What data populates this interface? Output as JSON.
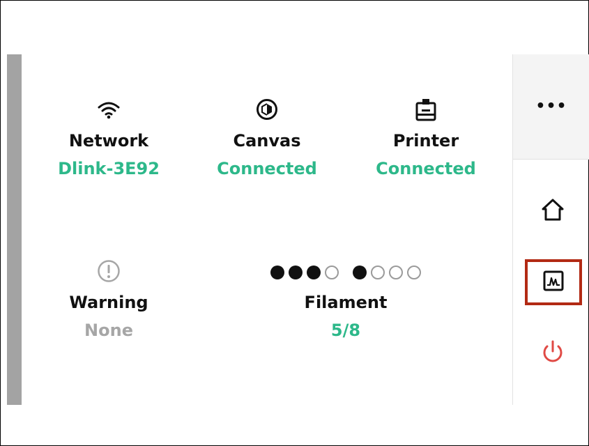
{
  "status": {
    "network": {
      "icon": "wifi-icon",
      "label": "Network",
      "value": "Dlink-3E92"
    },
    "canvas": {
      "icon": "canvas-cube-icon",
      "label": "Canvas",
      "value": "Connected"
    },
    "printer": {
      "icon": "printer-icon",
      "label": "Printer",
      "value": "Connected"
    },
    "warning": {
      "icon": "warning-circle-icon",
      "label": "Warning",
      "value": "None"
    },
    "filament": {
      "label": "Filament",
      "value": "5/8",
      "slots": [
        true,
        true,
        true,
        false,
        true,
        false,
        false,
        false
      ]
    }
  },
  "sidebar": {
    "more_label": "•••",
    "items": [
      {
        "name": "home",
        "icon": "home-icon"
      },
      {
        "name": "activity",
        "icon": "activity-chart-icon",
        "highlighted": true
      },
      {
        "name": "power",
        "icon": "power-icon"
      }
    ]
  },
  "colors": {
    "accent": "#2db88a",
    "muted": "#a6a6a6",
    "highlight_border": "#b22a14",
    "power": "#e04a45"
  }
}
